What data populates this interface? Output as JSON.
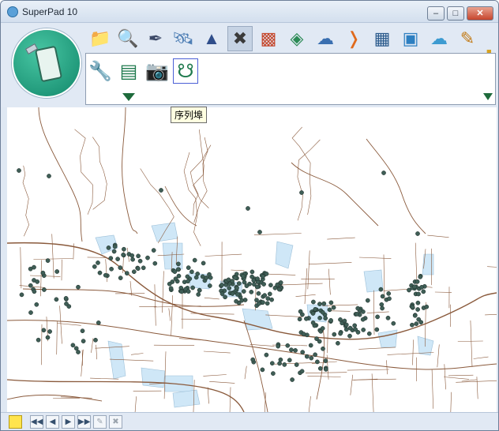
{
  "window": {
    "title": "SuperPad 10",
    "minimize_label": "–",
    "maximize_label": "□",
    "close_label": "✕"
  },
  "toolbar": {
    "row1_icons": [
      "folder-icon",
      "search-map-icon",
      "pen-edit-icon",
      "satellite-icon",
      "measure-icon",
      "tools-icon",
      "laptop-icon",
      "map-view-icon",
      "cloud-download-icon",
      "signal-icon",
      "grid-layer-icon",
      "world-map-icon",
      "cloud-sync-icon",
      "pencil-icon"
    ],
    "panel_icons": [
      "wrench-icon",
      "window-layout-icon",
      "camera-icon",
      "usb-icon"
    ],
    "selected_row1_icon": "tools-icon",
    "active_panel_icon": "usb-icon",
    "tooltip": "序列埠"
  },
  "status": {
    "buttons": [
      "lock-icon",
      "first-page-icon",
      "prev-page-icon",
      "next-page-icon",
      "last-page-icon",
      "pencil-disabled-icon",
      "close-disabled-icon"
    ]
  },
  "map": {
    "road_color": "#8a5a3c",
    "water_color": "#cfe7f7",
    "point_color": "#3f5e56"
  }
}
